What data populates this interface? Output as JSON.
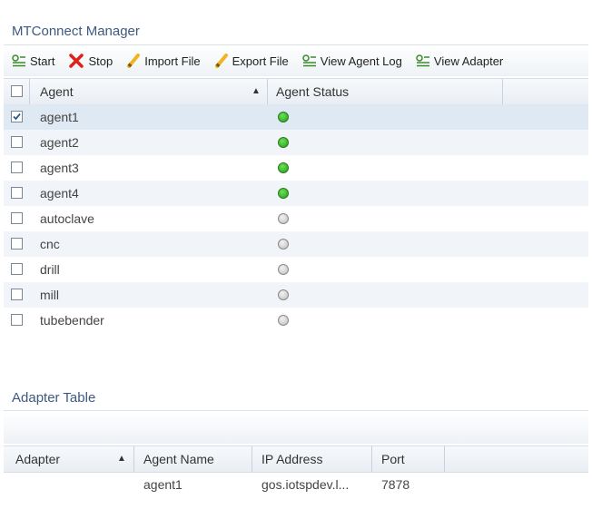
{
  "manager": {
    "title": "MTConnect Manager"
  },
  "toolbar": {
    "start_label": "Start",
    "stop_label": "Stop",
    "import_label": "Import File",
    "export_label": "Export File",
    "view_log_label": "View Agent Log",
    "view_adapter_label": "View Adapter"
  },
  "agent_table": {
    "columns": {
      "agent": "Agent",
      "status": "Agent Status"
    },
    "sort_indicator": "▲",
    "rows": [
      {
        "name": "agent1",
        "status": "running",
        "status_color": "#2ca01f",
        "checked": true
      },
      {
        "name": "agent2",
        "status": "running",
        "status_color": "#2ca01f",
        "checked": false
      },
      {
        "name": "agent3",
        "status": "running",
        "status_color": "#2ca01f",
        "checked": false
      },
      {
        "name": "agent4",
        "status": "running",
        "status_color": "#2ca01f",
        "checked": false
      },
      {
        "name": "autoclave",
        "status": "stopped",
        "status_color": "#bdbdbd",
        "checked": false
      },
      {
        "name": "cnc",
        "status": "stopped",
        "status_color": "#bdbdbd",
        "checked": false
      },
      {
        "name": "drill",
        "status": "stopped",
        "status_color": "#bdbdbd",
        "checked": false
      },
      {
        "name": "mill",
        "status": "stopped",
        "status_color": "#bdbdbd",
        "checked": false
      },
      {
        "name": "tubebender",
        "status": "stopped",
        "status_color": "#bdbdbd",
        "checked": false
      }
    ]
  },
  "adapter_table": {
    "title": "Adapter Table",
    "columns": {
      "adapter": "Adapter",
      "agent_name": "Agent Name",
      "ip": "IP Address",
      "port": "Port"
    },
    "sort_indicator": "▲",
    "rows": [
      {
        "adapter": "",
        "agent_name": "agent1",
        "ip": "gos.iotspdev.l...",
        "port": "7878"
      }
    ]
  },
  "colors": {
    "title": "#3d5a80",
    "stop_icon": "#e0201b",
    "pencil": "#f2b41c"
  }
}
